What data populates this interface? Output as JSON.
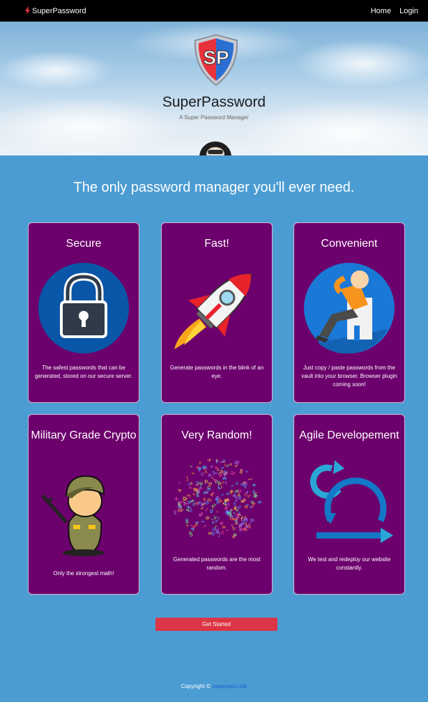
{
  "nav": {
    "brand": "SuperPassword",
    "brand_icon": "lightning-icon",
    "links": [
      "Home",
      "Login"
    ]
  },
  "hero": {
    "logo_text": "SP",
    "title": "SuperPassword",
    "subtitle": "A Super Password Manager"
  },
  "tagline": "The only password manager you'll ever need.",
  "cards": [
    {
      "title": "Secure",
      "icon": "padlock-icon",
      "text": "The safest passwords that can be generated, stored on our secure server."
    },
    {
      "title": "Fast!",
      "icon": "rocket-icon",
      "text": "Generate passwords in the blink of an eye."
    },
    {
      "title": "Convenient",
      "icon": "relaxing-person-icon",
      "text": "Just copy / paste passwords from the vault into your browser. Browser plugin coming soon!"
    },
    {
      "title": "Military Grade Crypto",
      "icon": "soldier-icon",
      "text": "Only the strongest math!"
    },
    {
      "title": "Very Random!",
      "icon": "random-characters-icon",
      "text": "Generated passwords are the most random."
    },
    {
      "title": "Agile Developement",
      "icon": "agile-cycle-icon",
      "text": "We test and redeploy our website constantly."
    }
  ],
  "cta": {
    "label": "Get Started"
  },
  "footer": {
    "prefix": "Copyright © ",
    "link": "superpass.htb"
  },
  "colors": {
    "navbar": "#000000",
    "page": "#4b9cd3",
    "card": "#6c006c",
    "button": "#dc3545",
    "logo_red": "#e8323c",
    "logo_blue": "#2a6fd4"
  }
}
